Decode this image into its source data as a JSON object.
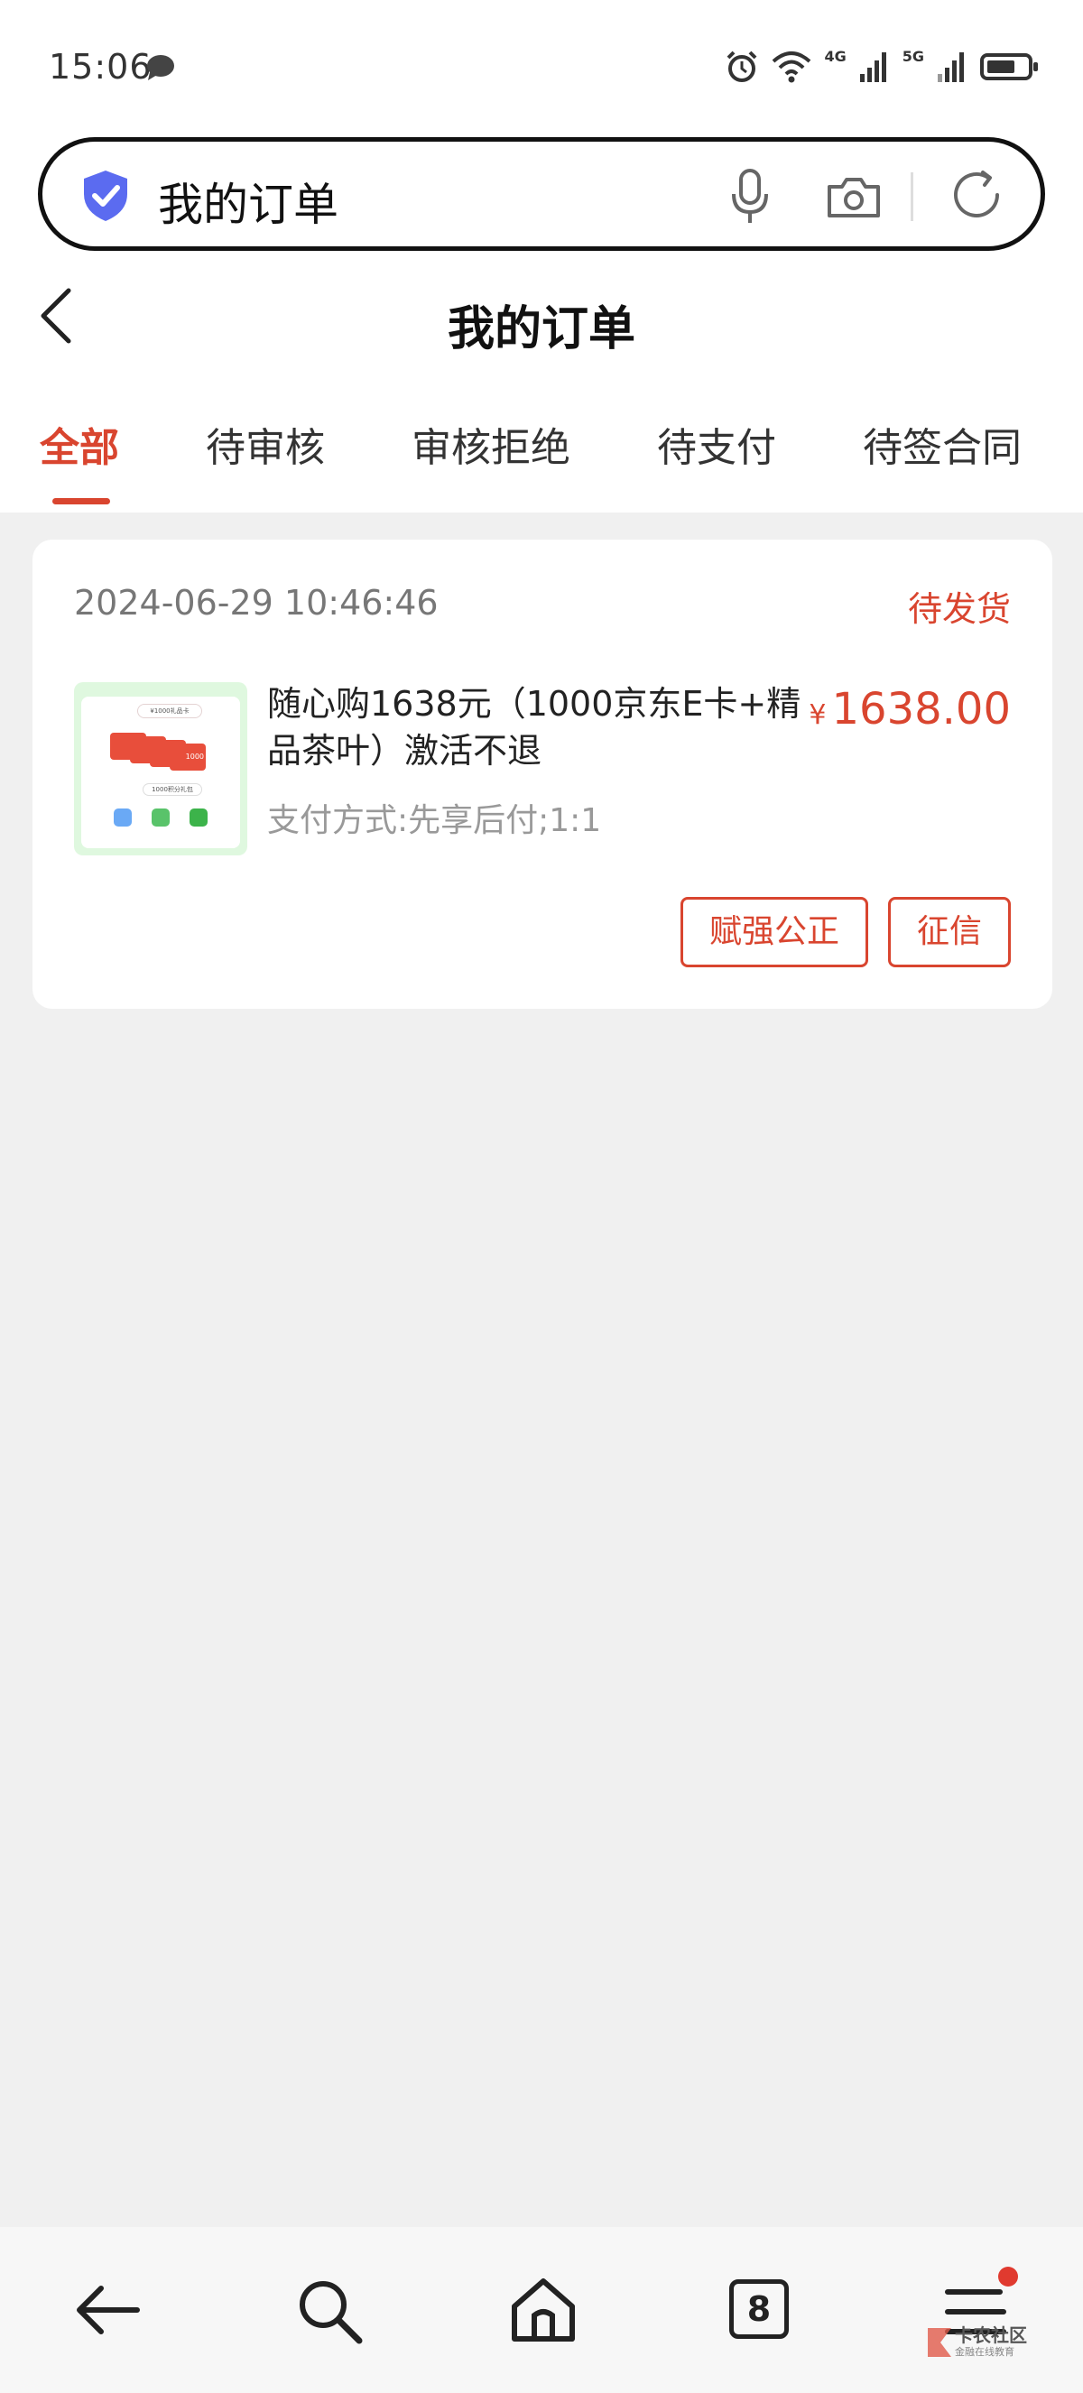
{
  "status_bar": {
    "time": "15:06",
    "network_4g": "4G",
    "network_5g": "5G"
  },
  "search": {
    "text": "我的订单"
  },
  "header": {
    "title": "我的订单"
  },
  "tabs": [
    {
      "label": "全部",
      "active": true
    },
    {
      "label": "待审核",
      "active": false
    },
    {
      "label": "审核拒绝",
      "active": false
    },
    {
      "label": "待支付",
      "active": false
    },
    {
      "label": "待签合同",
      "active": false
    }
  ],
  "order": {
    "time": "2024-06-29 10:46:46",
    "status": "待发货",
    "title": "随心购1638元（1000京东E卡+精品茶叶）激活不退",
    "payment": "支付方式:先享后付;1:1",
    "currency_symbol": "¥",
    "price": "1638.00",
    "buttons": [
      "赋强公正",
      "征信"
    ],
    "thumbnail": {
      "top_label": "¥1000礼品卡",
      "mid_label": "1000积分礼包",
      "card_value": "1000"
    }
  },
  "bottom_nav": {
    "tab_count": "8",
    "watermark": "卡农社区",
    "watermark_sub": "金融在线教育"
  },
  "colors": {
    "accent": "#d9452f",
    "background": "#f0f0f0",
    "card": "#ffffff"
  }
}
